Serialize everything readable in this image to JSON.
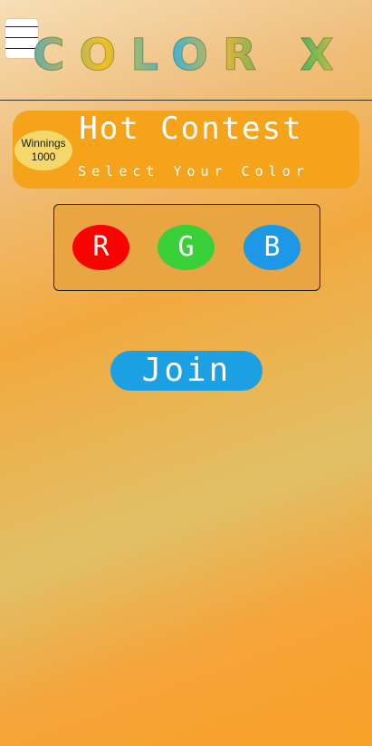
{
  "header": {
    "menu_icon": "hamburger-menu-icon",
    "title": "COLOR X"
  },
  "contest": {
    "winnings_label": "Winnings",
    "winnings_amount": "1000",
    "title": "Hot Contest",
    "subtitle": "Select Your Color"
  },
  "colors": [
    {
      "label": "R",
      "color": "#ff0000"
    },
    {
      "label": "G",
      "color": "#3ad03a"
    },
    {
      "label": "B",
      "color": "#1d98e6"
    }
  ],
  "join_label": "Join",
  "theme": {
    "card_color": "#f4a31a",
    "badge_color": "#f5d86a",
    "join_color": "#1d9fe4"
  }
}
